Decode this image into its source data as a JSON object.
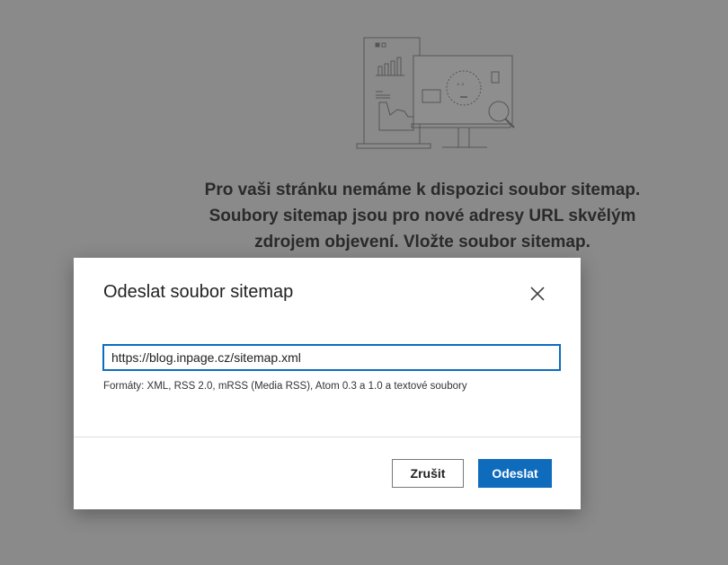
{
  "empty_state": {
    "message_lines": [
      "Pro vaši stránku nemáme k dispozici soubor sitemap.",
      "Soubory sitemap jsou pro nové adresy URL skvělým",
      "zdrojem objevení. Vložte soubor sitemap."
    ]
  },
  "dialog": {
    "title": "Odeslat soubor sitemap",
    "url_value": "https://blog.inpage.cz/sitemap.xml",
    "hint": "Formáty: XML, RSS 2.0, mRSS (Media RSS), Atom 0.3 a 1.0 a textové soubory",
    "cancel_label": "Zrušit",
    "submit_label": "Odeslat"
  },
  "colors": {
    "accent": "#0f6cbd",
    "overlay": "#8a8a8a"
  }
}
